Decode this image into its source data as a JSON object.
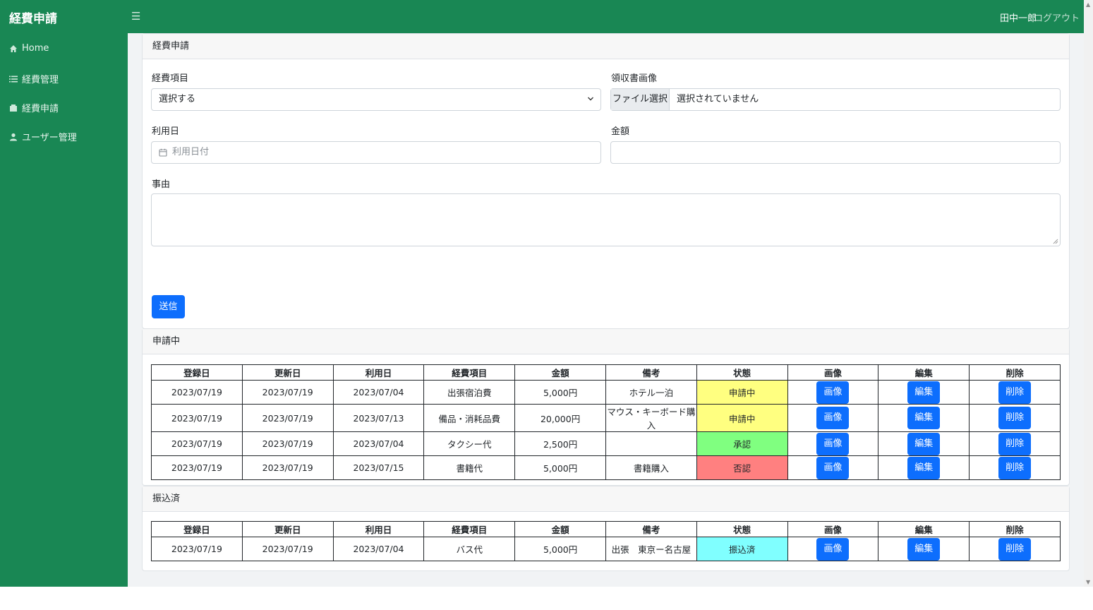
{
  "header": {
    "brand": "経費申請",
    "user_name": "田中一郎",
    "logout": "ログアウト"
  },
  "sidebar": {
    "items": [
      {
        "label": "Home",
        "icon": "home-icon"
      },
      {
        "label": "経費管理",
        "icon": "list-icon"
      },
      {
        "label": "経費申請",
        "icon": "document-icon"
      },
      {
        "label": "ユーザー管理",
        "icon": "user-icon"
      }
    ]
  },
  "form": {
    "card_title": "経費申請",
    "expense_item_label": "経費項目",
    "expense_item_value": "選択する",
    "receipt_label": "領収書画像",
    "file_button": "ファイル選択",
    "file_status": "選択されていません",
    "date_label": "利用日",
    "date_placeholder": "利用日付",
    "amount_label": "金額",
    "reason_label": "事由",
    "submit": "送信"
  },
  "columns": [
    "登録日",
    "更新日",
    "利用日",
    "経費項目",
    "金額",
    "備考",
    "状態",
    "画像",
    "編集",
    "削除"
  ],
  "pending": {
    "title": "申請中",
    "rows": [
      {
        "registered": "2023/07/19",
        "updated": "2023/07/19",
        "used": "2023/07/04",
        "item": "出張宿泊費",
        "amount": "5,000円",
        "note": "ホテル一泊",
        "status": "申請中",
        "status_color": "#ffff80",
        "image": "画像",
        "edit": "編集",
        "delete": "削除"
      },
      {
        "registered": "2023/07/19",
        "updated": "2023/07/19",
        "used": "2023/07/13",
        "item": "備品・消耗品費",
        "amount": "20,000円",
        "note": "マウス・キーボード購入",
        "status": "申請中",
        "status_color": "#ffff80",
        "image": "画像",
        "edit": "編集",
        "delete": "削除"
      },
      {
        "registered": "2023/07/19",
        "updated": "2023/07/19",
        "used": "2023/07/04",
        "item": "タクシー代",
        "amount": "2,500円",
        "note": "",
        "status": "承認",
        "status_color": "#80ff80",
        "image": "画像",
        "edit": "編集",
        "delete": "削除"
      },
      {
        "registered": "2023/07/19",
        "updated": "2023/07/19",
        "used": "2023/07/15",
        "item": "書籍代",
        "amount": "5,000円",
        "note": "書籍購入",
        "status": "否認",
        "status_color": "#ff8080",
        "image": "画像",
        "edit": "編集",
        "delete": "削除"
      }
    ]
  },
  "transferred": {
    "title": "振込済",
    "rows": [
      {
        "registered": "2023/07/19",
        "updated": "2023/07/19",
        "used": "2023/07/04",
        "item": "バス代",
        "amount": "5,000円",
        "note": "出張　東京ー名古屋",
        "status": "振込済",
        "status_color": "#80ffff",
        "image": "画像",
        "edit": "編集",
        "delete": "削除"
      }
    ]
  },
  "colors": {
    "brand_green": "#198754",
    "primary_blue": "#0d6efd"
  }
}
